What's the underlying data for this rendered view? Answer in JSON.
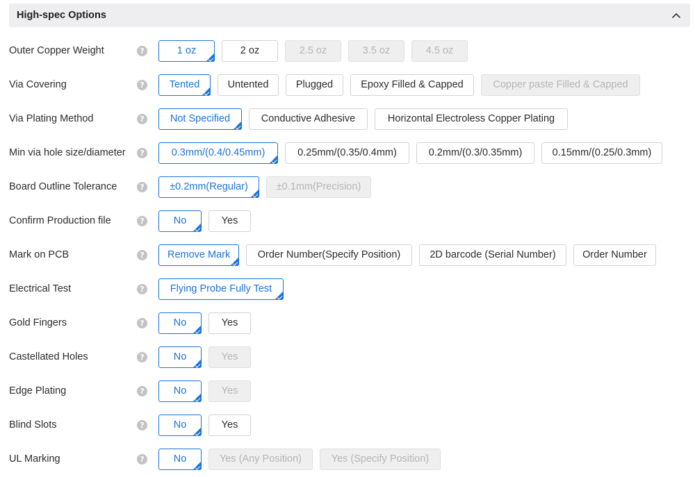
{
  "header": {
    "title": "High-spec Options"
  },
  "rows": [
    {
      "label": "Outer Copper Weight",
      "options": [
        {
          "label": "1 oz",
          "state": "selected"
        },
        {
          "label": "2 oz",
          "state": "normal"
        },
        {
          "label": "2.5 oz",
          "state": "disabled"
        },
        {
          "label": "3.5 oz",
          "state": "disabled"
        },
        {
          "label": "4.5 oz",
          "state": "disabled"
        }
      ]
    },
    {
      "label": "Via Covering",
      "options": [
        {
          "label": "Tented",
          "state": "selected"
        },
        {
          "label": "Untented",
          "state": "normal"
        },
        {
          "label": "Plugged",
          "state": "normal"
        },
        {
          "label": "Epoxy Filled & Capped",
          "state": "normal"
        },
        {
          "label": "Copper paste Filled & Capped",
          "state": "disabled"
        }
      ]
    },
    {
      "label": "Via Plating Method",
      "options": [
        {
          "label": "Not Specified",
          "state": "selected"
        },
        {
          "label": "Conductive Adhesive",
          "state": "normal"
        },
        {
          "label": "Horizontal Electroless Copper Plating",
          "state": "normal"
        }
      ]
    },
    {
      "label": "Min via hole size/diameter",
      "options": [
        {
          "label": "0.3mm/(0.4/0.45mm)",
          "state": "selected"
        },
        {
          "label": "0.25mm/(0.35/0.4mm)",
          "state": "normal"
        },
        {
          "label": "0.2mm/(0.3/0.35mm)",
          "state": "normal"
        },
        {
          "label": "0.15mm/(0.25/0.3mm)",
          "state": "normal"
        }
      ]
    },
    {
      "label": "Board Outline Tolerance",
      "options": [
        {
          "label": "±0.2mm(Regular)",
          "state": "selected"
        },
        {
          "label": "±0.1mm(Precision)",
          "state": "disabled"
        }
      ]
    },
    {
      "label": "Confirm Production file",
      "options": [
        {
          "label": "No",
          "state": "selected"
        },
        {
          "label": "Yes",
          "state": "normal"
        }
      ]
    },
    {
      "label": "Mark on PCB",
      "options": [
        {
          "label": "Remove Mark",
          "state": "selected"
        },
        {
          "label": "Order Number(Specify Position)",
          "state": "normal"
        },
        {
          "label": "2D barcode (Serial Number)",
          "state": "normal"
        },
        {
          "label": "Order Number",
          "state": "normal"
        }
      ]
    },
    {
      "label": "Electrical Test",
      "options": [
        {
          "label": "Flying Probe Fully Test",
          "state": "selected"
        }
      ]
    },
    {
      "label": "Gold Fingers",
      "options": [
        {
          "label": "No",
          "state": "selected"
        },
        {
          "label": "Yes",
          "state": "normal"
        }
      ]
    },
    {
      "label": "Castellated Holes",
      "options": [
        {
          "label": "No",
          "state": "selected"
        },
        {
          "label": "Yes",
          "state": "disabled"
        }
      ]
    },
    {
      "label": "Edge Plating",
      "options": [
        {
          "label": "No",
          "state": "selected"
        },
        {
          "label": "Yes",
          "state": "disabled"
        }
      ]
    },
    {
      "label": "Blind Slots",
      "options": [
        {
          "label": "No",
          "state": "selected"
        },
        {
          "label": "Yes",
          "state": "normal"
        }
      ]
    },
    {
      "label": "UL Marking",
      "options": [
        {
          "label": "No",
          "state": "selected"
        },
        {
          "label": "Yes (Any Position)",
          "state": "disabled"
        },
        {
          "label": "Yes (Specify Position)",
          "state": "disabled"
        }
      ]
    }
  ],
  "icons": {
    "help": "question-circle-icon",
    "collapse": "chevron-up-icon"
  },
  "colors": {
    "accent": "#1a73d9",
    "header_bg": "#eeeef1",
    "disabled_bg": "#efefef",
    "disabled_text": "#b5b5b5"
  }
}
